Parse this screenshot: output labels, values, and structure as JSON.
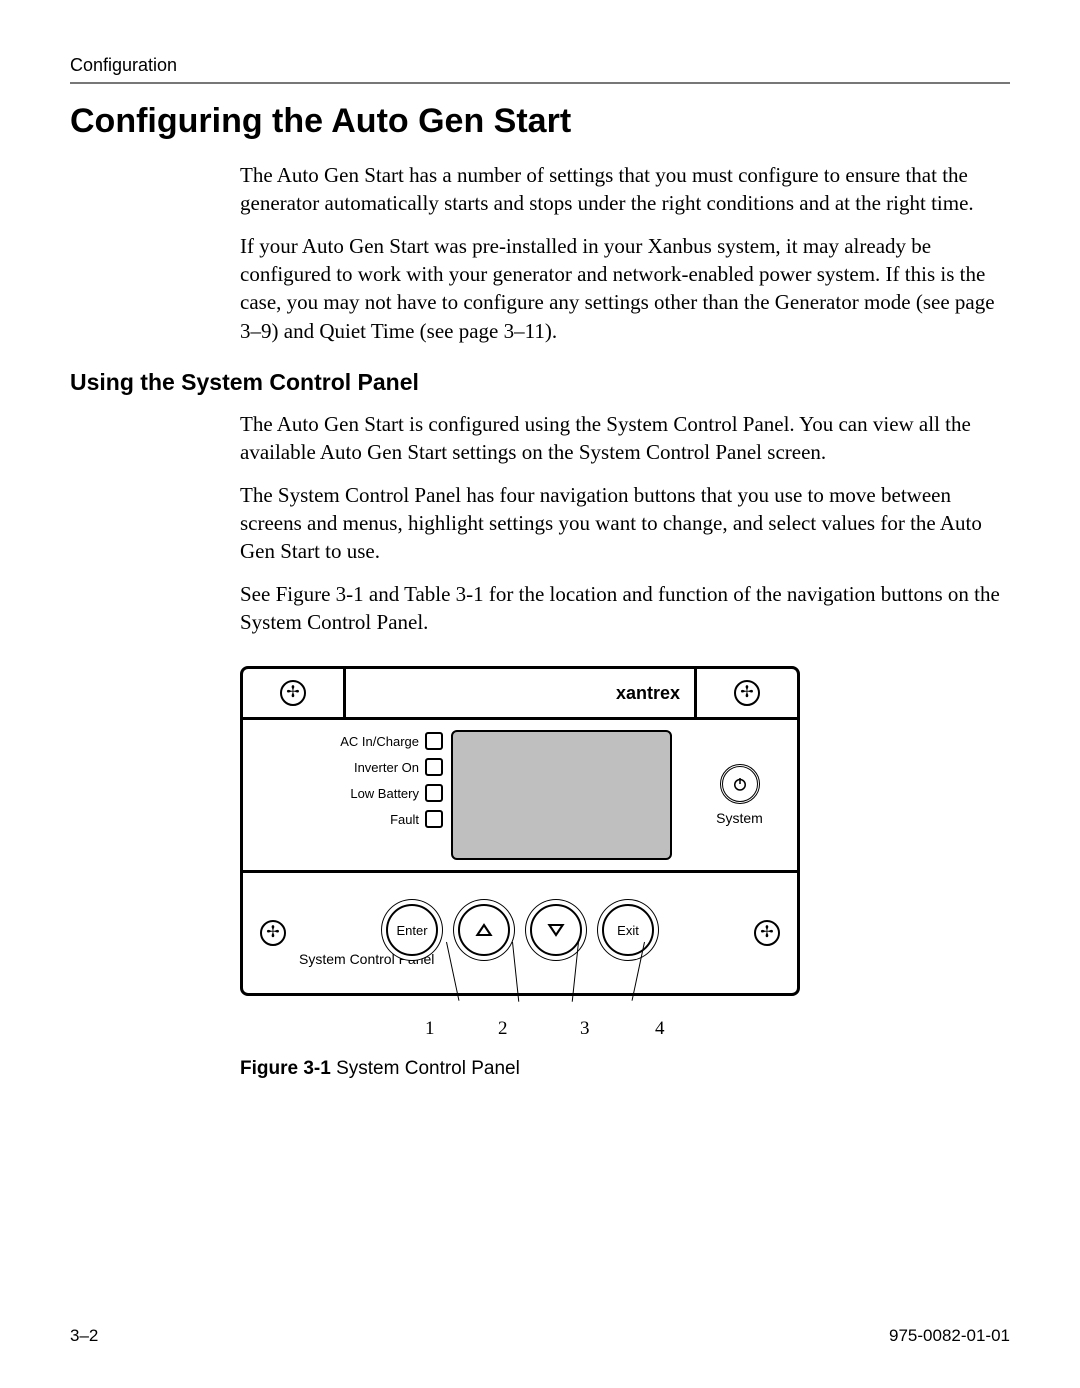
{
  "header": {
    "section": "Configuration"
  },
  "title": "Configuring the Auto Gen Start",
  "paragraphs": {
    "p1": "The Auto Gen Start has a number of settings that you must configure to ensure that the generator automatically starts and stops under the right conditions and at the right time.",
    "p2": "If your Auto Gen Start was pre-installed in your Xanbus system, it may already be configured to work with your generator and network-enabled power system. If this is the case, you may not have to configure any settings other than the Generator mode (see page 3–9) and Quiet Time (see page 3–11)."
  },
  "subheading": "Using the System Control Panel",
  "sub_paragraphs": {
    "s1": "The Auto Gen Start is configured using the System Control Panel. You can view all the available Auto Gen Start settings on the System Control Panel screen.",
    "s2": "The System Control Panel has four navigation buttons that you use to move between screens and menus, highlight settings you want to change, and select values for the Auto Gen Start to use.",
    "s3": "See Figure 3-1 and Table 3-1 for the location and function of the navigation buttons on the System Control Panel."
  },
  "device": {
    "brand": "xantrex",
    "leds": [
      "AC In/Charge",
      "Inverter On",
      "Low Battery",
      "Fault"
    ],
    "system_label": "System",
    "footer_label": "System Control Panel",
    "buttons": {
      "enter": "Enter",
      "exit": "Exit"
    },
    "callouts": [
      "1",
      "2",
      "3",
      "4"
    ]
  },
  "figure": {
    "label": "Figure 3-1",
    "caption": "System Control Panel"
  },
  "footer": {
    "left": "3–2",
    "right": "975-0082-01-01"
  }
}
